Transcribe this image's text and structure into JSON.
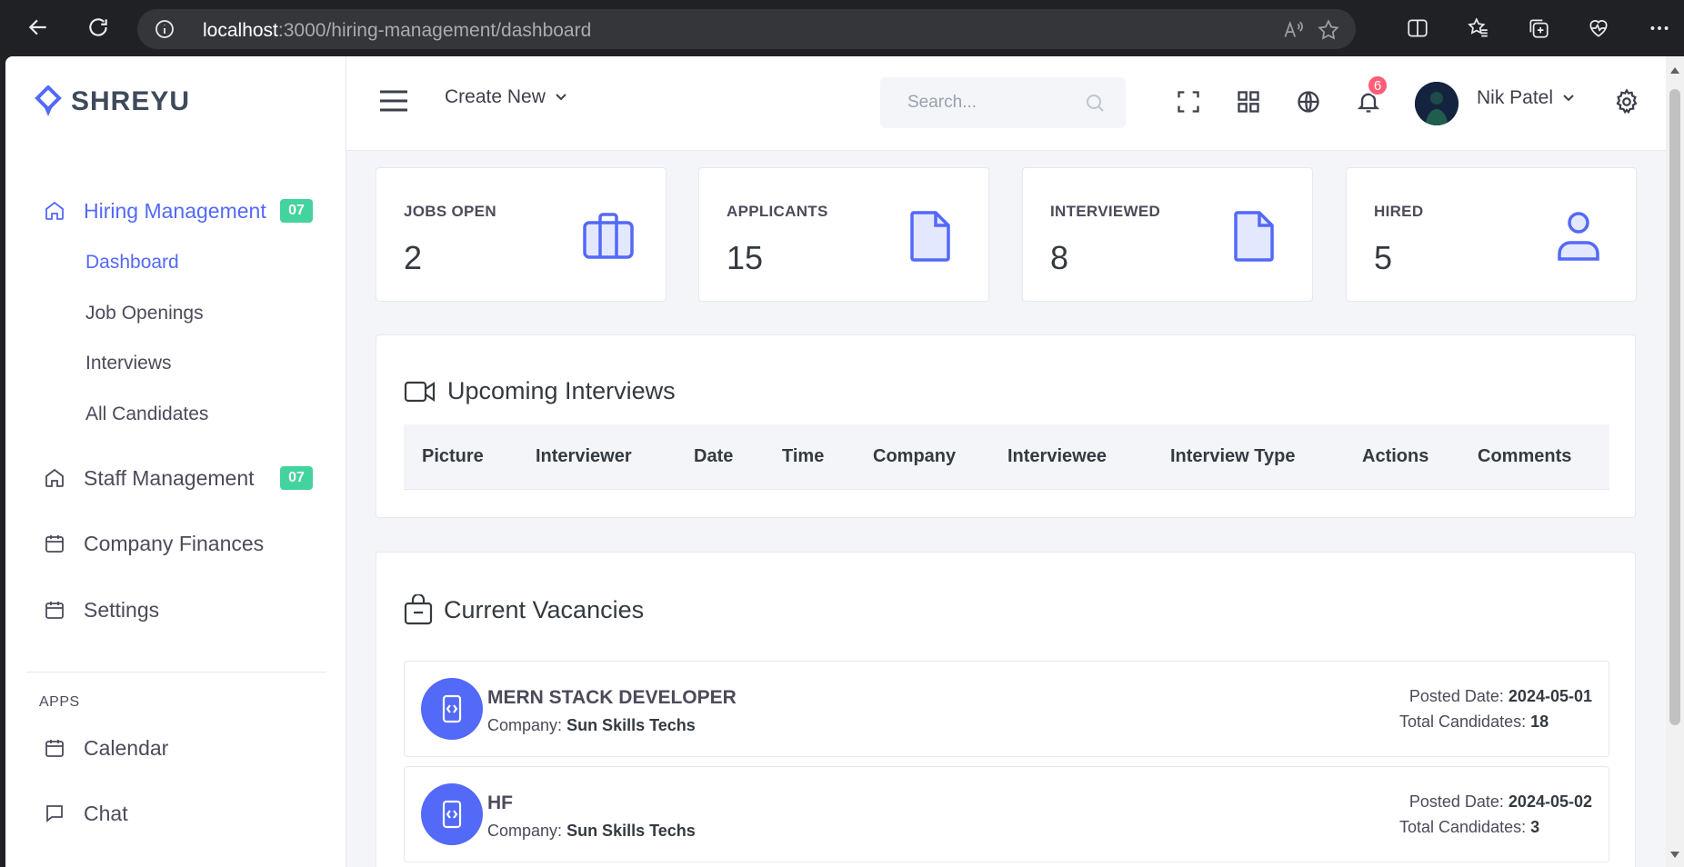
{
  "browser": {
    "url_host": "localhost",
    "url_path": ":3000/hiring-management/dashboard"
  },
  "sidebar": {
    "logo": "SHREYU",
    "menu": [
      {
        "label": "Hiring Management",
        "badge": "07",
        "icon": "home-icon"
      },
      {
        "label": "Staff Management",
        "badge": "07",
        "icon": "home-icon"
      },
      {
        "label": "Company Finances",
        "icon": "calendar-icon"
      },
      {
        "label": "Settings",
        "icon": "calendar-icon"
      }
    ],
    "submenu": [
      "Dashboard",
      "Job Openings",
      "Interviews",
      "All Candidates"
    ],
    "apps_title": "APPS",
    "apps": [
      {
        "label": "Calendar",
        "icon": "calendar-icon"
      },
      {
        "label": "Chat",
        "icon": "chat-icon"
      }
    ]
  },
  "topbar": {
    "create_new": "Create New",
    "search_placeholder": "Search...",
    "notification_count": "6",
    "user_name": "Nik Patel"
  },
  "stats": [
    {
      "label": "JOBS OPEN",
      "value": "2",
      "icon": "briefcase-icon"
    },
    {
      "label": "APPLICANTS",
      "value": "15",
      "icon": "file-icon"
    },
    {
      "label": "INTERVIEWED",
      "value": "8",
      "icon": "file-icon"
    },
    {
      "label": "HIRED",
      "value": "5",
      "icon": "user-icon"
    }
  ],
  "interviews": {
    "title": "Upcoming Interviews",
    "columns": [
      "Picture",
      "Interviewer",
      "Date",
      "Time",
      "Company",
      "Interviewee",
      "Interview Type",
      "Actions",
      "Comments"
    ]
  },
  "vacancies": {
    "title": "Current Vacancies",
    "company_label": "Company:",
    "posted_label": "Posted Date:",
    "candidates_label": "Total Candidates:",
    "items": [
      {
        "title": "MERN STACK DEVELOPER",
        "company": "Sun Skills Techs",
        "posted": "2024-05-01",
        "candidates": "18"
      },
      {
        "title": "HF",
        "company": "Sun Skills Techs",
        "posted": "2024-05-02",
        "candidates": "3"
      }
    ]
  },
  "colors": {
    "primary": "#5369f8",
    "success": "#43d39e",
    "danger": "#ff5c75"
  }
}
